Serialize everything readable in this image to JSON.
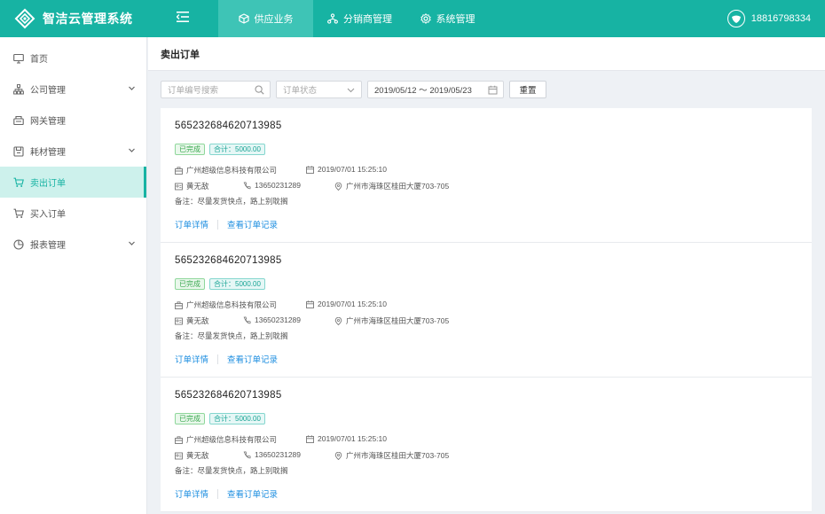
{
  "app": {
    "title": "智洁云管理系统"
  },
  "topnav": [
    {
      "label": "供应业务",
      "active": true
    },
    {
      "label": "分销商管理",
      "active": false
    },
    {
      "label": "系统管理",
      "active": false
    }
  ],
  "user": {
    "phone": "18816798334"
  },
  "sidebar": {
    "items": [
      {
        "label": "首页",
        "icon": "monitor-icon"
      },
      {
        "label": "公司管理",
        "icon": "org-icon"
      },
      {
        "label": "网关管理",
        "icon": "gateway-icon"
      },
      {
        "label": "耗材管理",
        "icon": "consumable-icon"
      },
      {
        "label": "卖出订单",
        "icon": "cart-icon",
        "active": true
      },
      {
        "label": "买入订单",
        "icon": "cart-icon"
      },
      {
        "label": "报表管理",
        "icon": "pie-chart-icon"
      }
    ]
  },
  "page": {
    "title": "卖出订单"
  },
  "filters": {
    "search_placeholder": "订单编号搜索",
    "status_placeholder": "订单状态",
    "date_range": "2019/05/12 ～ 2019/05/23",
    "reset_label": "重置"
  },
  "orders": [
    {
      "id": "565232684620713985",
      "status": "已完成",
      "total": "合计：5000.00",
      "company": "广州超级信息科技有限公司",
      "datetime": "2019/07/01 15:25:10",
      "contact": "黄无敌",
      "phone": "13650231289",
      "address": "广州市海珠区桂田大厦703-705",
      "note": "备注：尽量发货快点，路上别耽搁",
      "detail_link": "订单详情",
      "record_link": "查看订单记录"
    },
    {
      "id": "565232684620713985",
      "status": "已完成",
      "total": "合计：5000.00",
      "company": "广州超级信息科技有限公司",
      "datetime": "2019/07/01 15:25:10",
      "contact": "黄无敌",
      "phone": "13650231289",
      "address": "广州市海珠区桂田大厦703-705",
      "note": "备注：尽量发货快点，路上别耽搁",
      "detail_link": "订单详情",
      "record_link": "查看订单记录"
    },
    {
      "id": "565232684620713985",
      "status": "已完成",
      "total": "合计：5000.00",
      "company": "广州超级信息科技有限公司",
      "datetime": "2019/07/01 15:25:10",
      "contact": "黄无敌",
      "phone": "13650231289",
      "address": "广州市海珠区桂田大厦703-705",
      "note": "备注：尽量发货快点，路上别耽搁",
      "detail_link": "订单详情",
      "record_link": "查看订单记录"
    }
  ],
  "colors": {
    "primary": "#17b3a3",
    "link": "#1f8fe0",
    "success": "#3aa84f"
  }
}
